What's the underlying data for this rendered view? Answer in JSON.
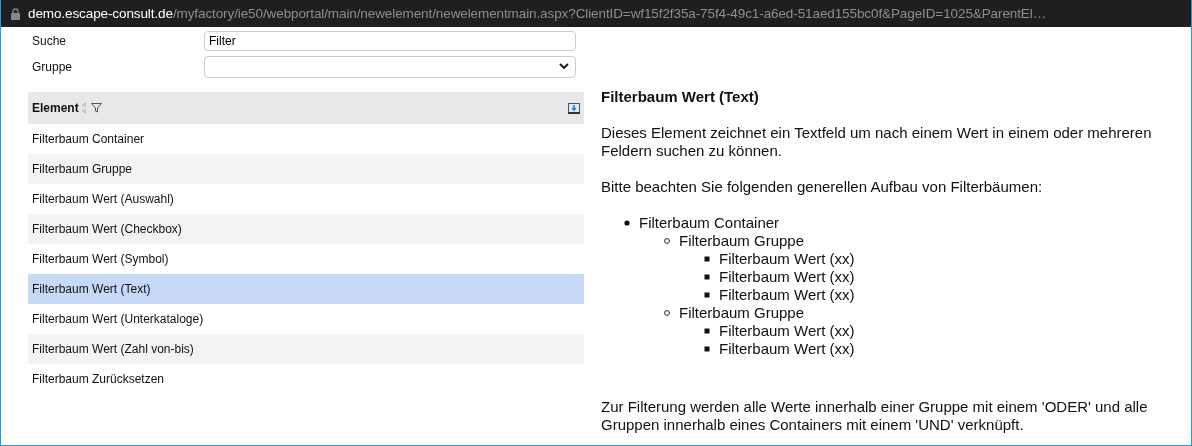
{
  "address_bar": {
    "host": "demo.escape-consult.de",
    "path": "/myfactory/ie50/webportal/main/newelement/newelementmain.aspx?ClientID=wf15f2f35a-75f4-49c1-a6ed-51aed155bc0f&PageID=1025&ParentEl…"
  },
  "form": [
    {
      "kind": "text",
      "label": "Suche",
      "value": "Filter"
    },
    {
      "kind": "select",
      "label": "Gruppe"
    }
  ],
  "table": {
    "column": "Element",
    "rows": [
      {
        "label": "Filterbaum Container",
        "selected": false
      },
      {
        "label": "Filterbaum Gruppe",
        "selected": false
      },
      {
        "label": "Filterbaum Wert (Auswahl)",
        "selected": false
      },
      {
        "label": "Filterbaum Wert (Checkbox)",
        "selected": false
      },
      {
        "label": "Filterbaum Wert (Symbol)",
        "selected": false
      },
      {
        "label": "Filterbaum Wert (Text)",
        "selected": true
      },
      {
        "label": "Filterbaum Wert (Unterkataloge)",
        "selected": false
      },
      {
        "label": "Filterbaum Wert (Zahl von-bis)",
        "selected": false
      },
      {
        "label": "Filterbaum Zurücksetzen",
        "selected": false
      }
    ]
  },
  "detail": {
    "title": "Filterbaum Wert (Text)",
    "intro": "Dieses Element zeichnet ein Textfeld um nach einem Wert in einem oder mehreren Feldern suchen zu können.",
    "lead": "Bitte beachten Sie folgenden generellen Aufbau von Filterbäumen:",
    "tree": [
      {
        "label": "Filterbaum Container",
        "children": [
          {
            "label": "Filterbaum Gruppe",
            "children": [
              {
                "label": "Filterbaum Wert (xx)"
              },
              {
                "label": "Filterbaum Wert (xx)"
              },
              {
                "label": "Filterbaum Wert (xx)"
              }
            ]
          },
          {
            "label": "Filterbaum Gruppe",
            "children": [
              {
                "label": "Filterbaum Wert (xx)"
              },
              {
                "label": "Filterbaum Wert (xx)"
              }
            ]
          }
        ]
      }
    ],
    "footer": "Zur Filterung werden alle Werte innerhalb einer Gruppe mit einem 'ODER' und alle Gruppen innerhalb eines Containers mit einem 'UND' verknüpft."
  }
}
